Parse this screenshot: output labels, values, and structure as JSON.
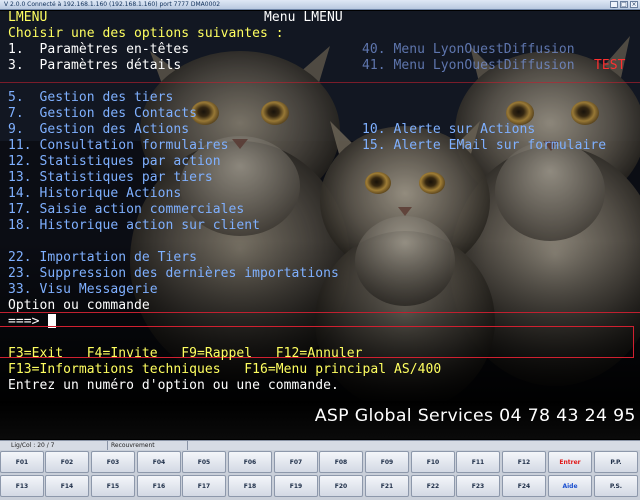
{
  "window": {
    "title": "V 2.0.0 Connecté à 192.168.1.160 (192.168.1.160) port 7777  DMA0002"
  },
  "screen": {
    "program": "LMENU",
    "menu_title": "Menu LMENU",
    "prompt": "Choisir une des options suivantes :",
    "options_left": [
      "1.  Paramètres en-têtes",
      "3.  Paramètres détails",
      "5.  Gestion des tiers",
      "7.  Gestion des Contacts",
      "9.  Gestion des Actions",
      "11. Consultation formulaires",
      "12. Statistiques par action",
      "13. Statistiques par tiers",
      "14. Historique Actions",
      "17. Saisie action commerciales",
      "18. Historique action sur client",
      "22. Importation de Tiers",
      "23. Suppression des dernières importations",
      "33. Visu Messagerie"
    ],
    "options_right": [
      "40. Menu LyonOuestDiffusion",
      "41. Menu LyonOuestDiffusion",
      "10. Alerte sur Actions",
      "15. Alerte EMail sur formulaire"
    ],
    "test_tag": "TEST",
    "command_label": "Option ou commande",
    "command_arrow": "===>",
    "fkey_line1": "F3=Exit   F4=Invite   F9=Rappel   F12=Annuler",
    "fkey_line2": "F13=Informations techniques   F16=Menu principal AS/400",
    "message": "Entrez un numéro d'option ou une commande."
  },
  "brand": "ASP Global Services  04 78 43 24 95",
  "status": {
    "cursor": "Lig/Col : 20 / 7",
    "mode": "Recouvrement"
  },
  "fkeys_row1": [
    "F01",
    "F02",
    "F03",
    "F04",
    "F05",
    "F06",
    "F07",
    "F08",
    "F09",
    "F10",
    "F11",
    "F12",
    "Entrer",
    "P.P."
  ],
  "fkeys_row2": [
    "F13",
    "F14",
    "F15",
    "F16",
    "F17",
    "F18",
    "F19",
    "F20",
    "F21",
    "F22",
    "F23",
    "F24",
    "Aide",
    "P.S."
  ],
  "colors": {
    "green": "#34e04c",
    "blue": "#7fb0ff",
    "yellow": "#ffff60",
    "red": "#ff3030",
    "white": "#ffffff"
  }
}
